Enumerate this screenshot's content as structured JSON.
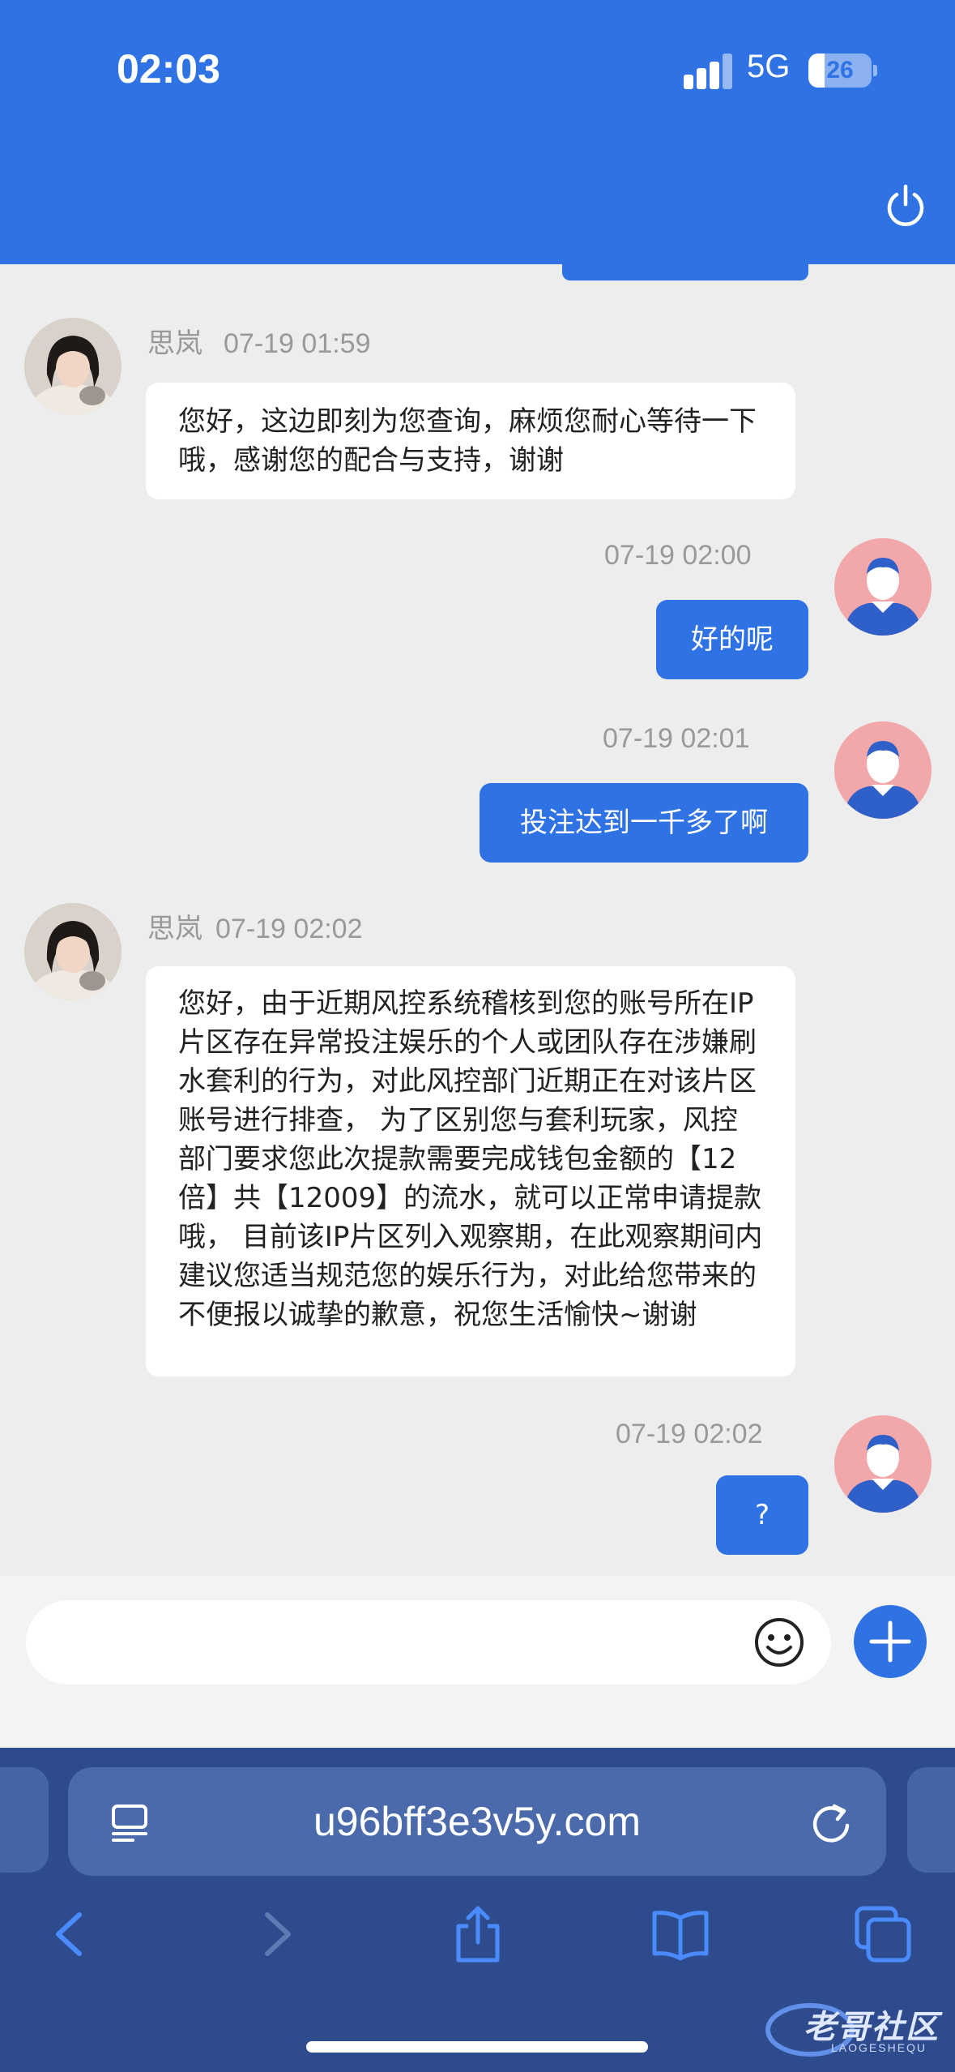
{
  "status_bar": {
    "time": "02:03",
    "network": "5G",
    "battery": "26",
    "battery_level": 0.26
  },
  "messages": [
    {
      "from": "agent",
      "name": "思岚",
      "time": "07-19 01:59",
      "text": "您好，这边即刻为您查询，麻烦您耐心等待一下哦，感谢您的配合与支持，谢谢"
    },
    {
      "from": "user",
      "time": "07-19 02:00",
      "text": "好的呢"
    },
    {
      "from": "user",
      "time": "07-19 02:01",
      "text": "投注达到一千多了啊"
    },
    {
      "from": "agent",
      "name": "思岚",
      "time": "07-19 02:02",
      "text": "您好，由于近期风控系统稽核到您的账号所在IP片区存在异常投注娱乐的个人或团队存在涉嫌刷水套利的行为，对此风控部门近期正在对该片区账号进行排查， 为了区别您与套利玩家，风控部门要求您此次提款需要完成钱包金额的【12倍】共【12009】的流水，就可以正常申请提款哦， 目前该IP片区列入观察期，在此观察期间内建议您适当规范您的娱乐行为，对此给您带来的不便报以诚挚的歉意，祝您生活愉快~谢谢"
    },
    {
      "from": "user",
      "time": "07-19 02:02",
      "text": "?"
    }
  ],
  "composer": {
    "placeholder": "",
    "icons": [
      "emoji-icon",
      "plus-icon"
    ]
  },
  "browser": {
    "url": "u96bff3e3v5y.com",
    "icons": [
      "tabs-icon",
      "reload-icon",
      "back-icon",
      "forward-icon",
      "share-icon",
      "bookmarks-icon",
      "tab-switcher-icon"
    ]
  },
  "watermark": {
    "text": "老哥社区",
    "sub": "LAOGESHEQU"
  },
  "colors": {
    "brand_blue": "#2f72e4",
    "chat_bg": "#ededed",
    "browser_bg": "#2e4b8d"
  }
}
